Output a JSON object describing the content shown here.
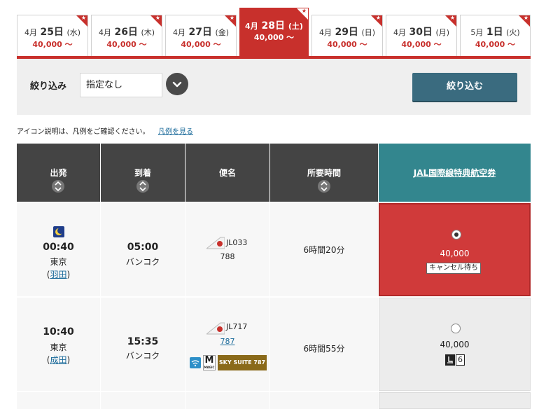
{
  "date_tabs": [
    {
      "month": "4月",
      "day": "25日",
      "weekday": "(水)",
      "price": "40,000 〜",
      "active": false
    },
    {
      "month": "4月",
      "day": "26日",
      "weekday": "(木)",
      "price": "40,000 〜",
      "active": false
    },
    {
      "month": "4月",
      "day": "27日",
      "weekday": "(金)",
      "price": "40,000 〜",
      "active": false
    },
    {
      "month": "4月",
      "day": "28日",
      "weekday": "(土)",
      "price": "40,000 〜",
      "active": true
    },
    {
      "month": "4月",
      "day": "29日",
      "weekday": "(日)",
      "price": "40,000 〜",
      "active": false
    },
    {
      "month": "4月",
      "day": "30日",
      "weekday": "(月)",
      "price": "40,000 〜",
      "active": false
    },
    {
      "month": "5月",
      "day": "1日",
      "weekday": "(火)",
      "price": "40,000 〜",
      "active": false
    }
  ],
  "filter": {
    "label": "絞り込み",
    "selected": "指定なし",
    "button_label": "絞り込む"
  },
  "legend": {
    "note": "アイコン説明は、凡例をご確認ください。",
    "link": "凡例を見る"
  },
  "table": {
    "headers": {
      "departure": "出発",
      "arrival": "到着",
      "flight": "便名",
      "duration": "所要時間",
      "award": "JAL国際線特典航空券"
    },
    "rows": [
      {
        "dep_time": "00:40",
        "dep_city": "東京",
        "dep_airport": "羽田",
        "arr_time": "05:00",
        "arr_city": "バンコク",
        "flight_no": "JL033",
        "aircraft": "788",
        "duration": "6時間20分",
        "award_price": "40,000",
        "award_status": "キャンセル待ち",
        "selected": true
      },
      {
        "dep_time": "10:40",
        "dep_city": "東京",
        "dep_airport": "成田",
        "arr_time": "15:35",
        "arr_city": "バンコク",
        "flight_no": "JL717",
        "aircraft": "787",
        "duration": "6時間55分",
        "award_price": "40,000",
        "seats": "6",
        "badges": {
          "magic": "M",
          "magic_sub": "MAGIC",
          "suite": "SKY SUITE 787"
        },
        "selected": false
      }
    ]
  },
  "colors": {
    "accent_red": "#c8302c",
    "header_dark": "#444444",
    "header_teal": "#33868e",
    "filter_button": "#3a6b7f"
  }
}
